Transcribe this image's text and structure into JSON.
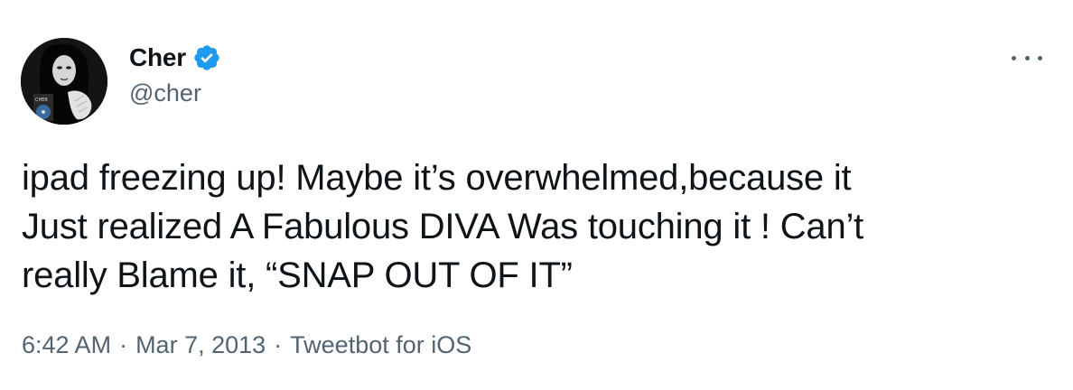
{
  "author": {
    "display_name": "Cher",
    "handle": "@cher",
    "verified_icon": "verified-badge-icon",
    "avatar_icon": "profile-photo",
    "badge_color": "#1d9bf0"
  },
  "tweet": {
    "lines": [
      "ipad freezing up! Maybe it’s overwhelmed,because it",
      "Just realized A Fabulous DIVA Was touching it ! Can’t",
      "really Blame it, “SNAP OUT OF IT”"
    ],
    "time": "6:42 AM",
    "separator": "·",
    "date": "Mar 7, 2013",
    "source": "Tweetbot for iOS"
  },
  "more_icon": "more-options-icon"
}
